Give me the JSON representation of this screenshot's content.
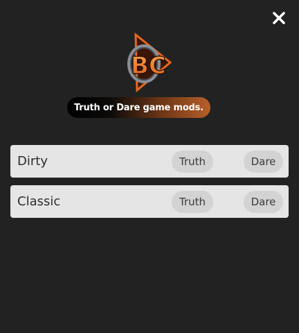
{
  "header": {
    "close_icon": "close-icon",
    "logo_icon": "bc-logo-icon",
    "logo_text": "BC",
    "tagline": "Truth or Dare game mods."
  },
  "modes": [
    {
      "name": "Dirty",
      "truth_label": "Truth",
      "dare_label": "Dare"
    },
    {
      "name": "Classic",
      "truth_label": "Truth",
      "dare_label": "Dare"
    }
  ],
  "colors": {
    "background": "#222222",
    "row_background": "#e5e5e5",
    "pill_background": "#d3d3d3",
    "accent": "#f07a2a"
  }
}
